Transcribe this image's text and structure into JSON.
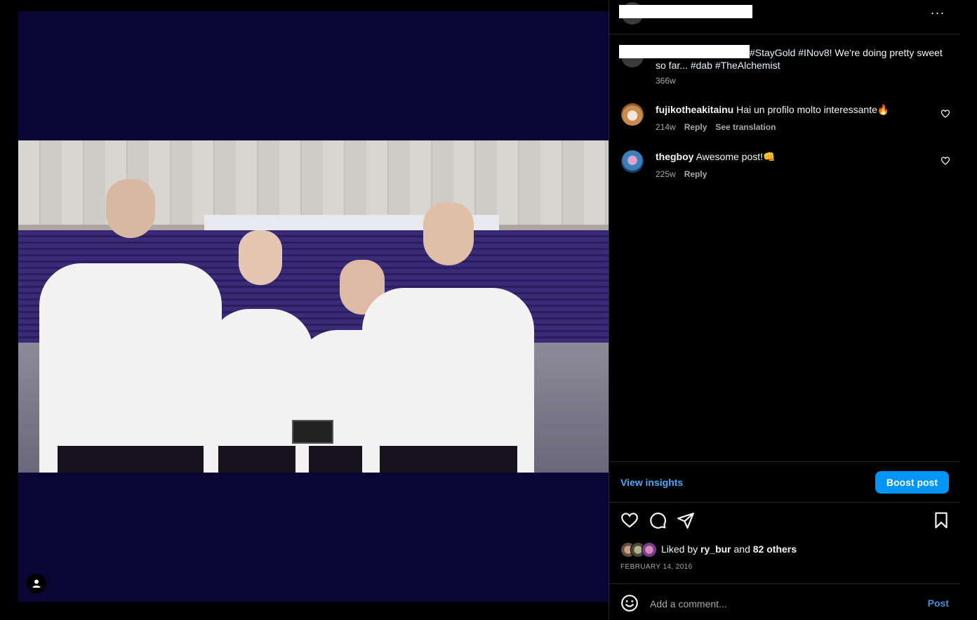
{
  "header": {
    "more_label": "···"
  },
  "caption": {
    "text_before": "",
    "tags": [
      "#StayGold",
      "#INov8"
    ],
    "text_middle": "! We're doing pretty sweet so far... ",
    "tags_end": [
      "#dab",
      "#TheAlchemist"
    ],
    "time": "366w"
  },
  "comments": [
    {
      "username": "fujikotheakitainu",
      "text": "Hai un profilo molto interessante🔥",
      "time": "214w",
      "reply_label": "Reply",
      "translate_label": "See translation"
    },
    {
      "username": "thegboy",
      "text": "Awesome post!👊",
      "time": "225w",
      "reply_label": "Reply"
    }
  ],
  "insights": {
    "view_label": "View insights",
    "boost_label": "Boost post"
  },
  "likes": {
    "prefix": "Liked by ",
    "first_liker": "ry_bur",
    "conjunction": " and ",
    "others": "82 others"
  },
  "post_date": "FEBRUARY 14, 2016",
  "comment_box": {
    "placeholder": "Add a comment...",
    "post_label": "Post"
  },
  "colors": {
    "background": "#000000",
    "media_backdrop": "#0b0533",
    "link_blue": "#4aa8ff",
    "boost_button": "#0095f6",
    "hashtag": "#e0f1ff",
    "secondary_text": "#a8a8a8"
  }
}
